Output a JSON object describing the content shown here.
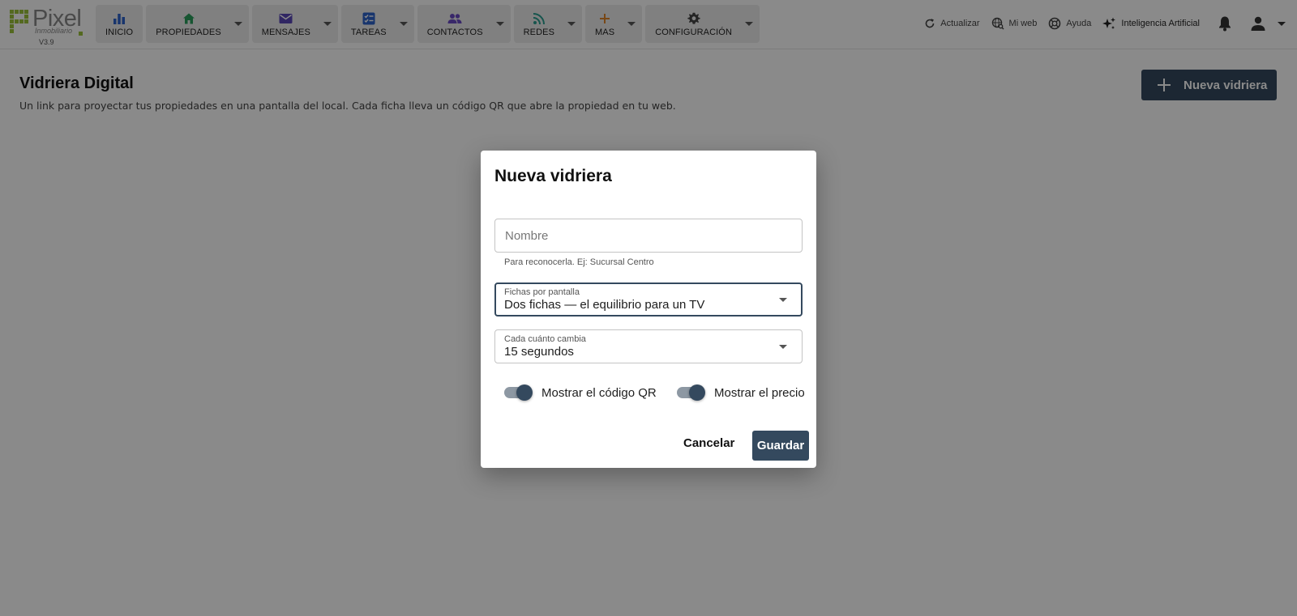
{
  "brand": {
    "name": "Pixel",
    "sub": "Inmobiliario",
    "version": "V3.9",
    "accent": "#9bc23c"
  },
  "nav": [
    {
      "label": "INICIO",
      "icon": "bar-chart-icon",
      "color": "#2e63c9",
      "dropdown": false
    },
    {
      "label": "PROPIEDADES",
      "icon": "home-icon",
      "color": "#2a9d5c",
      "dropdown": true
    },
    {
      "label": "MENSAJES",
      "icon": "mail-icon",
      "color": "#5a46b8",
      "dropdown": true
    },
    {
      "label": "TAREAS",
      "icon": "tasks-icon",
      "color": "#2e63c9",
      "dropdown": true
    },
    {
      "label": "CONTACTOS",
      "icon": "people-icon",
      "color": "#6a4bc4",
      "dropdown": true
    },
    {
      "label": "REDES",
      "icon": "share-icon",
      "color": "#2a9d8f",
      "dropdown": true
    },
    {
      "label": "MAS",
      "icon": "plus-icon",
      "color": "#e0862a",
      "dropdown": true
    },
    {
      "label": "CONFIGURACIÓN",
      "icon": "gear-icon",
      "color": "#444444",
      "dropdown": true
    }
  ],
  "tools": {
    "refresh": "Actualizar",
    "web": "Mi web",
    "help": "Ayuda",
    "ai": "Inteligencia Artificial"
  },
  "page": {
    "title": "Vidriera Digital",
    "subtitle": "Un link para proyectar tus propiedades en una pantalla del local. Cada ficha lleva un código QR que abre la propiedad en tu web.",
    "new_button": "Nueva vidriera"
  },
  "dialog": {
    "title": "Nueva vidriera",
    "name_placeholder": "Nombre",
    "name_helper": "Para reconocerla. Ej: Sucursal Centro",
    "cards_label": "Fichas por pantalla",
    "cards_value": "Dos fichas — el equilibrio para un TV",
    "interval_label": "Cada cuánto cambia",
    "interval_value": "15 segundos",
    "toggle_qr_label": "Mostrar el código QR",
    "toggle_qr_on": true,
    "toggle_price_label": "Mostrar el precio",
    "toggle_price_on": true,
    "cancel": "Cancelar",
    "save": "Guardar"
  },
  "colors": {
    "primary": "#34495e",
    "overlay": "rgba(0,0,0,0.46)"
  }
}
